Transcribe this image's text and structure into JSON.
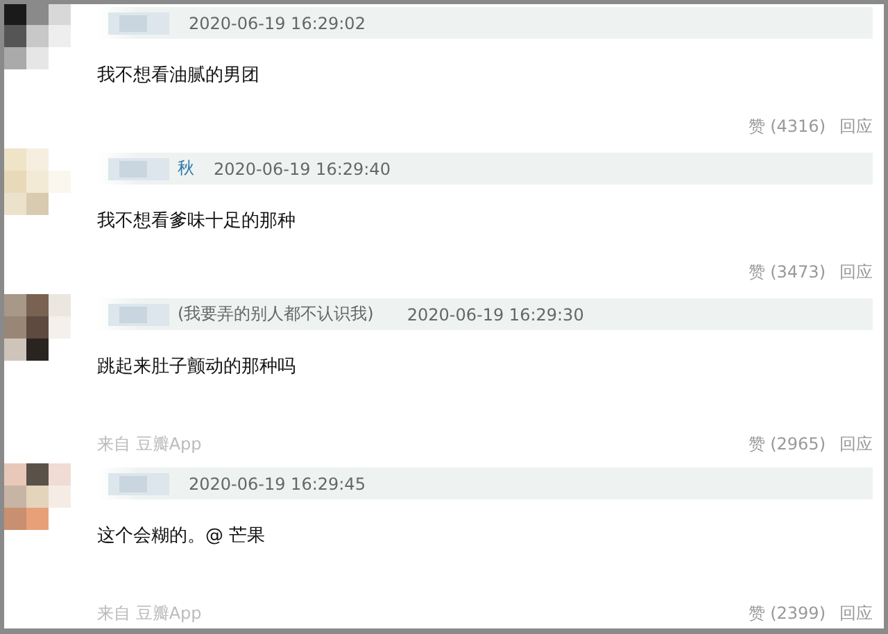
{
  "comments": [
    {
      "time": "2020-06-19 16:29:02",
      "text": "我不想看油腻的男团",
      "likes": "赞 (4316)",
      "reply": "回应"
    },
    {
      "name": "秋",
      "time": "2020-06-19 16:29:40",
      "text": "我不想看爹味十足的那种",
      "likes": "赞 (3473)",
      "reply": "回应"
    },
    {
      "name_note": "(我要弄的别人都不认识我)",
      "time": "2020-06-19 16:29:30",
      "text": "跳起来肚子颤动的那种吗",
      "source": "来自 豆瓣App",
      "likes": "赞 (2965)",
      "reply": "回应"
    },
    {
      "time": "2020-06-19 16:29:45",
      "text": "这个会糊的。@ 芒果",
      "source": "来自 豆瓣App",
      "likes": "赞 (2399)",
      "reply": "回应"
    }
  ]
}
